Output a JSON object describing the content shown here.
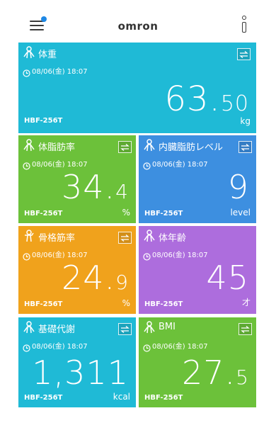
{
  "header": {
    "logo": "omron",
    "menu_icon": "menu-icon",
    "info_icon": "info-icon",
    "notification_color": "#1e88e5"
  },
  "tiles": {
    "weight": {
      "title": "体重",
      "date": "08/06(金) 18:07",
      "value_int": "63.",
      "value_dec": "50",
      "unit": "kg",
      "model": "HBF-256T",
      "color": "#1fbad6"
    },
    "body_fat": {
      "title": "体脂肪率",
      "date": "08/06(金) 18:07",
      "value_int": "34.",
      "value_dec": "4",
      "unit": "%",
      "model": "HBF-256T",
      "color": "#6cc13a"
    },
    "visceral": {
      "title": "内臓脂肪レベル",
      "date": "08/06(金) 18:07",
      "value_int": "9",
      "value_dec": "",
      "unit": "level",
      "model": "HBF-256T",
      "color": "#3d8fe0"
    },
    "skeletal": {
      "title": "骨格筋率",
      "date": "08/06(金) 18:07",
      "value_int": "24.",
      "value_dec": "9",
      "unit": "%",
      "model": "HBF-256T",
      "color": "#f0a21c"
    },
    "body_age": {
      "title": "体年齢",
      "date": "08/06(金) 18:07",
      "value_int": "45",
      "value_dec": "",
      "unit": "才",
      "model": "HBF-256T",
      "color": "#ad6ddd"
    },
    "bmr": {
      "title": "基礎代謝",
      "date": "08/06(金) 18:07",
      "value_int": "1,311",
      "value_dec": "",
      "unit": "kcal",
      "model": "HBF-256T",
      "color": "#1fbad6"
    },
    "bmi": {
      "title": "BMI",
      "date": "08/06(金) 18:07",
      "value_int": "27.",
      "value_dec": "5",
      "unit": "",
      "model": "HBF-256T",
      "color": "#6cc13a"
    }
  }
}
